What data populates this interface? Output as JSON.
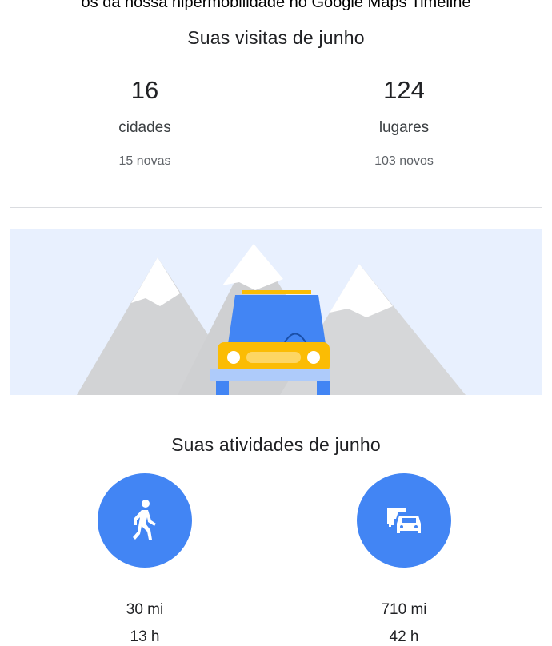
{
  "caption": "os da nossa hipermobilidade no Google Maps Timeline",
  "visits": {
    "title": "Suas visitas de junho",
    "cities": {
      "count": "16",
      "label": "cidades",
      "new": "15 novas"
    },
    "places": {
      "count": "124",
      "label": "lugares",
      "new": "103 novos"
    }
  },
  "banner": {
    "illustration": "car-driving-mountains"
  },
  "activities": {
    "title": "Suas atividades de junho",
    "walking": {
      "icon": "walking-icon",
      "distance": "30 mi",
      "time": "13 h"
    },
    "driving": {
      "icon": "driving-icon",
      "distance": "710 mi",
      "time": "42 h"
    }
  },
  "colors": {
    "accent": "#4285f4",
    "car_yellow": "#fbbc04",
    "sky": "#e8f0fe",
    "mountain": "#d2d3d5"
  }
}
